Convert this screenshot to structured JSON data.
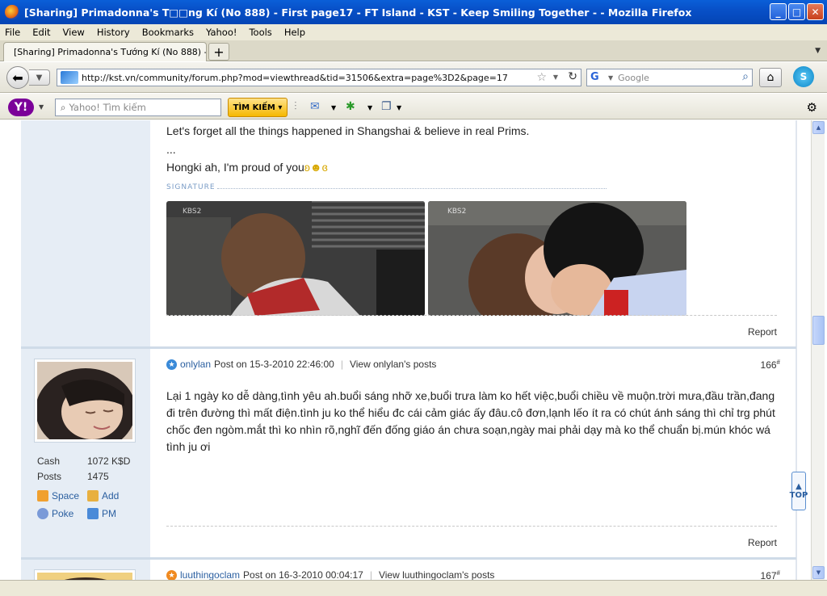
{
  "window": {
    "title": "[Sharing] Primadonna's T□□ng Kí (No 888) - First page17 - FT Island - KST - Keep Smiling Together - - Mozilla Firefox"
  },
  "menu": [
    "File",
    "Edit",
    "View",
    "History",
    "Bookmarks",
    "Yahoo!",
    "Tools",
    "Help"
  ],
  "tab": {
    "label": "[Sharing] Primadonna's Tướng Kí (No 888) - ..."
  },
  "nav": {
    "url": "http://kst.vn/community/forum.php?mod=viewthread&tid=31506&extra=page%3D2&page=17",
    "search_placeholder": "Google"
  },
  "yahoo": {
    "search_placeholder": "Yahoo! Tìm kiếm",
    "search_button": "TÌM KIẾM"
  },
  "post_prev": {
    "line1": "Let's forget all the things happened in Shangshai & believe in real Prims.",
    "line2": "...",
    "line3": "Hongki ah, I'm proud of you",
    "signature_label": "SIGNATURE",
    "img1_caption": "KBS2",
    "img2_caption": "KBS2",
    "report": "Report"
  },
  "post1": {
    "cash_label": "Cash",
    "cash_value": "1072 K$D",
    "posts_label": "Posts",
    "posts_value": "1475",
    "space": "Space",
    "add": "Add",
    "poke": "Poke",
    "pm": "PM",
    "author": "onlylan",
    "posted": "Post on 15-3-2010 22:46:00",
    "view_posts": "View onlylan's posts",
    "number": "166",
    "number_mark": "#",
    "body_l1": "Lại 1 ngày ko dễ dàng,tình yêu ah.buổi sáng nhỡ xe,buổi trưa làm ko hết việc,buổi chiều về muộn.trời mưa,đầu trần,đang",
    "body_l2": "đi trên đường thì mất điện.tình ju ko thể hiểu đc cái cảm giác ấy đâu.cô đơn,lạnh lếo ít ra có chút ánh sáng thì chỉ trg phút",
    "body_l3": "chốc đen ngòm.mắt thì ko nhìn rõ,nghĩ đến đống giáo án chưa soạn,ngày mai phải dạy mà ko thể chuẩn bị.mún khóc wá",
    "body_l4": "tình ju ơi",
    "report": "Report"
  },
  "post2": {
    "author": "luuthingoclam",
    "posted": "Post on 16-3-2010 00:04:17",
    "view_posts": "View luuthingoclam's posts",
    "number": "167",
    "number_mark": "#"
  },
  "colors": {
    "accent": "#2b5fa0",
    "sidebar": "#e6edf5",
    "titlebar": "#0a5fd8"
  }
}
